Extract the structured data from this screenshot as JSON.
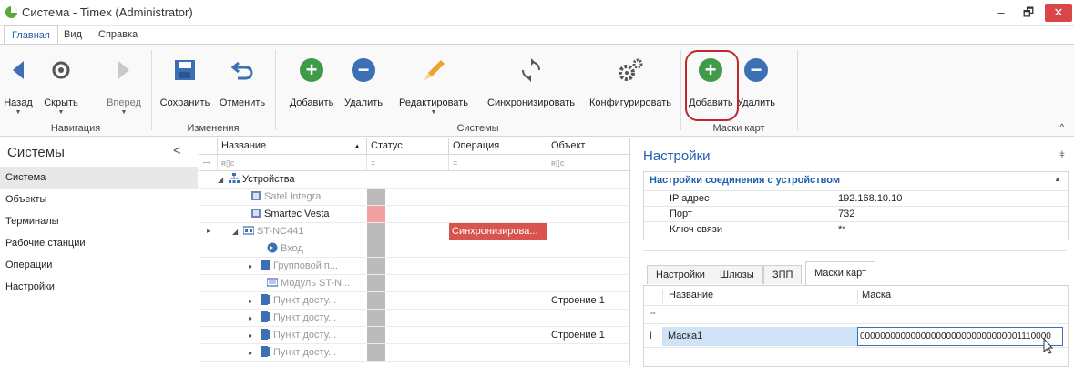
{
  "window": {
    "title": "Система - Timex (Administrator)",
    "minimize": "–",
    "restore": "🗗",
    "close": "✕"
  },
  "menu": {
    "tabs": [
      "Главная",
      "Вид",
      "Справка"
    ]
  },
  "ribbon": {
    "groups": [
      "Навигация",
      "Изменения",
      "Системы",
      "Маски карт"
    ],
    "buttons": {
      "back": "Назад",
      "hide": "Скрыть",
      "forward": "Вперед",
      "save": "Сохранить",
      "undo": "Отменить",
      "add": "Добавить",
      "delete": "Удалить",
      "edit": "Редактировать",
      "sync": "Синхронизировать",
      "configure": "Конфигурировать",
      "mask_add": "Добавить",
      "mask_delete": "Удалить"
    },
    "collapse": "^"
  },
  "left": {
    "title": "Системы",
    "collapse": "<",
    "items": [
      "Система",
      "Объекты",
      "Терминалы",
      "Рабочие станции",
      "Операции",
      "Настройки"
    ],
    "selected": "Система"
  },
  "grid": {
    "headers": {
      "name": "Название",
      "status": "Статус",
      "operation": "Операция",
      "object": "Объект"
    },
    "filter": {
      "pin": "ꟷ",
      "name": "ʀ▯c",
      "status": "=",
      "operation": "=",
      "object": "ʀ▯c"
    },
    "rows": [
      {
        "name": "Устройства",
        "status": "",
        "operation": "",
        "object": ""
      },
      {
        "name": "Satel Integra",
        "status": "",
        "operation": "",
        "object": ""
      },
      {
        "name": "Smartec Vesta",
        "status": "",
        "operation": "",
        "object": ""
      },
      {
        "name": "ST-NC441",
        "status": "",
        "operation": "Синхронизирова...",
        "object": ""
      },
      {
        "name": "Вход",
        "status": "",
        "operation": "",
        "object": ""
      },
      {
        "name": "Групповой п...",
        "status": "",
        "operation": "",
        "object": ""
      },
      {
        "name": "Модуль ST-N...",
        "status": "",
        "operation": "",
        "object": ""
      },
      {
        "name": "Пункт досту...",
        "status": "",
        "operation": "",
        "object": "Строение 1"
      },
      {
        "name": "Пункт досту...",
        "status": "",
        "operation": "",
        "object": ""
      },
      {
        "name": "Пункт досту...",
        "status": "",
        "operation": "",
        "object": "Строение 1"
      },
      {
        "name": "Пункт досту...",
        "status": "",
        "operation": "",
        "object": ""
      }
    ]
  },
  "settings": {
    "title": "Настройки",
    "pin": "ǂ",
    "section": "Настройки соединения с устройством",
    "props": [
      {
        "key": "IP адрес",
        "value": "192.168.10.10"
      },
      {
        "key": "Порт",
        "value": "732"
      },
      {
        "key": "Ключ связи",
        "value": "**"
      }
    ],
    "tabs": [
      "Настройки",
      "Шлюзы",
      "ЗПП",
      "Маски карт"
    ],
    "active_tab": "Маски карт",
    "mask_table": {
      "headers": [
        "Название",
        "Маска"
      ],
      "rows": [
        {
          "name": "Маска1",
          "mask": "00000000000000000000000000000001110000"
        }
      ]
    }
  },
  "colors": {
    "accent": "#1f5fb0",
    "sync_badge": "#d9534f",
    "status_red": "#f4a0a0",
    "highlight": "#c0272d"
  }
}
